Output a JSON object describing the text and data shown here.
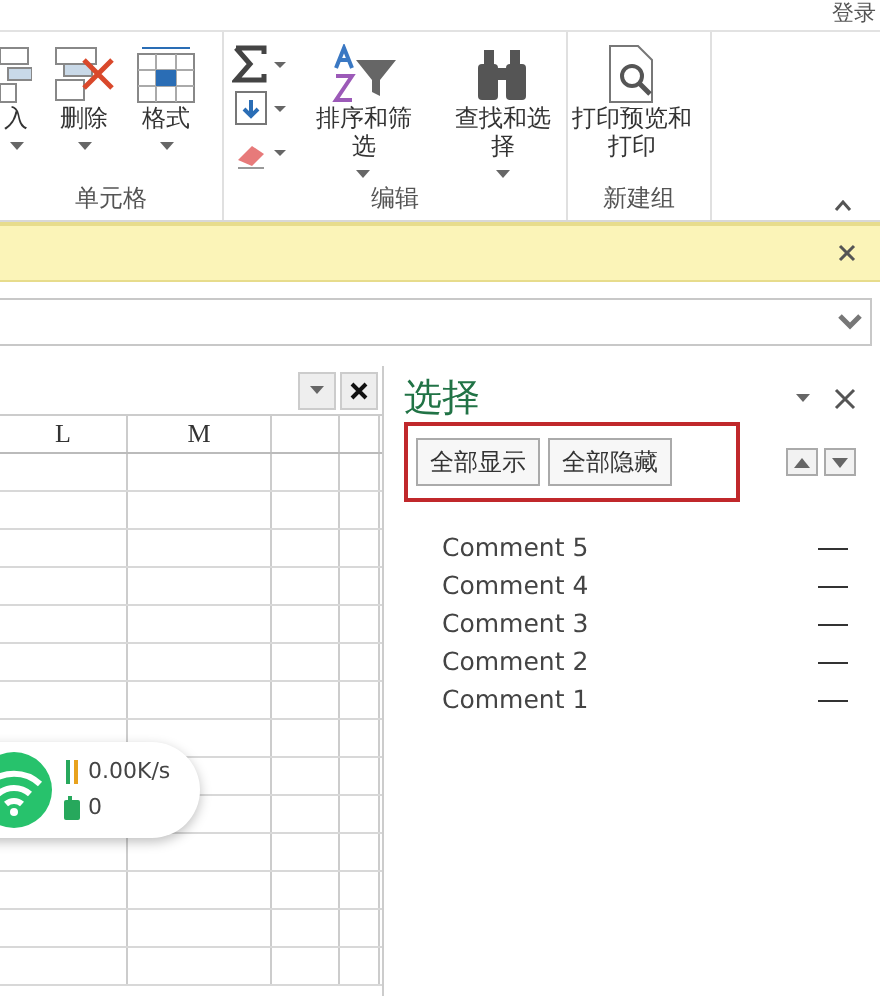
{
  "account": {
    "label": "登录"
  },
  "ribbon": {
    "groups": [
      {
        "label": "单元格",
        "buttons": [
          {
            "label": "入",
            "kind": "insert"
          },
          {
            "label": "删除",
            "kind": "delete"
          },
          {
            "label": "格式",
            "kind": "format"
          }
        ]
      },
      {
        "label": "编辑",
        "small_buttons": [
          {
            "kind": "sum"
          },
          {
            "kind": "fill"
          },
          {
            "kind": "clear"
          }
        ],
        "buttons": [
          {
            "label": "排序和筛选",
            "kind": "sort"
          },
          {
            "label": "查找和选择",
            "kind": "find"
          }
        ]
      },
      {
        "label": "新建组",
        "buttons": [
          {
            "label": "打印预览和打印",
            "kind": "print"
          }
        ]
      }
    ]
  },
  "sheet": {
    "columns": [
      "L",
      "M"
    ]
  },
  "selection_pane": {
    "title": "选择",
    "buttons": [
      "全部显示",
      "全部隐藏"
    ],
    "items": [
      {
        "name": "Comment 5"
      },
      {
        "name": "Comment 4"
      },
      {
        "name": "Comment 3"
      },
      {
        "name": "Comment 2"
      },
      {
        "name": "Comment 1"
      }
    ]
  },
  "network_widget": {
    "speed": "0.00K/s",
    "count": "0"
  }
}
